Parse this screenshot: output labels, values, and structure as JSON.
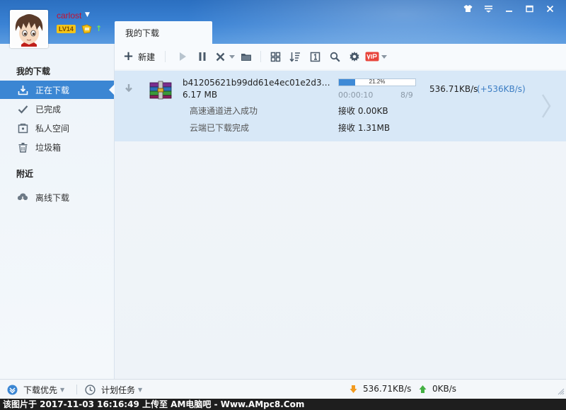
{
  "user": {
    "name": "carlost",
    "level": "LV14"
  },
  "tabs": {
    "active": "我的下载"
  },
  "toolbar": {
    "new_label": "新建"
  },
  "sidebar": {
    "section_downloads": "我的下载",
    "items": [
      {
        "label": "正在下载"
      },
      {
        "label": "已完成"
      },
      {
        "label": "私人空间"
      },
      {
        "label": "垃圾箱"
      }
    ],
    "section_nearby": "附近",
    "offline": "离线下载"
  },
  "task": {
    "filename": "b41205621b99dd61e4ec01e2d3857...",
    "size": "6.17 MB",
    "progress_text": "21.2%",
    "progress": 0.212,
    "elapsed": "00:00:10",
    "pieces": "8/9",
    "speed": "536.71KB/s",
    "boost": "(+536KB/s)",
    "sub_rows": [
      {
        "label": "高速通道进入成功",
        "value": "接收 0.00KB"
      },
      {
        "label": "云端已下载完成",
        "value": "接收 1.31MB"
      }
    ]
  },
  "statusbar": {
    "priority": "下载优先",
    "schedule": "计划任务",
    "down_speed": "536.71KB/s",
    "up_speed": "0KB/s"
  },
  "watermark": "该图片于 2017-11-03 16:16:49 上传至 AM电脑吧 - Www.AMpc8.Com",
  "colors": {
    "accent": "#3b86d3",
    "selected_row": "#d8e8f7",
    "boost_text": "#3d7ec4"
  }
}
